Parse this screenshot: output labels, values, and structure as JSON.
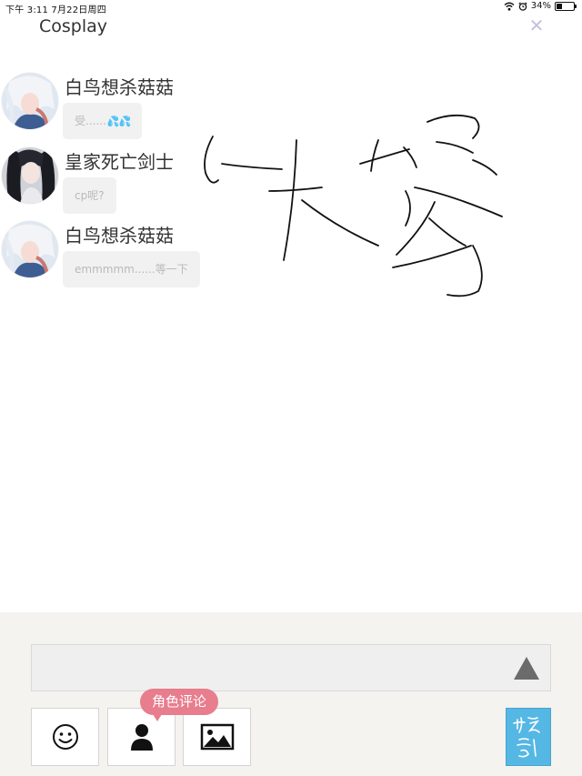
{
  "status_bar": {
    "time_date": "下午 3:11   7月22日周四",
    "battery": "34%",
    "battery_level": 0.34
  },
  "header": {
    "title": "Cosplay",
    "close_icon": "close-icon"
  },
  "messages": [
    {
      "name": "白鸟想杀菇菇",
      "text": "受......",
      "emoji": "💦💦"
    },
    {
      "name": "皇家死亡剑士",
      "text": "cp呢?"
    },
    {
      "name": "白鸟想杀菇菇",
      "text": "emmmmm......等一下"
    }
  ],
  "composer": {
    "send_icon": "triangle-up-icon",
    "tools": [
      {
        "icon": "smiley-icon"
      },
      {
        "icon": "person-icon",
        "tooltip": "角色评论"
      },
      {
        "icon": "image-icon"
      }
    ],
    "submit_icon": "handwritten-submit-icon"
  },
  "colors": {
    "accent_pink": "#e77d8d",
    "submit_blue": "#55b7e3",
    "panel_bg": "#f4f3ef"
  }
}
